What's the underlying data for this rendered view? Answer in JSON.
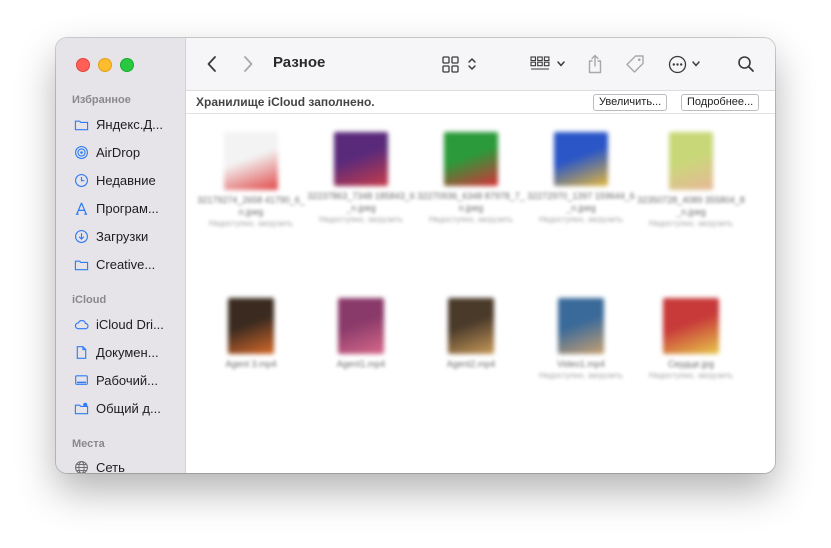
{
  "window": {
    "title": "Разное",
    "traffic_lights": [
      "close",
      "minimize",
      "zoom"
    ]
  },
  "sidebar": {
    "sections": [
      {
        "label": "Избранное",
        "items": [
          {
            "label": "Яндекс.Д...",
            "icon": "folder-icon"
          },
          {
            "label": "AirDrop",
            "icon": "airdrop-icon"
          },
          {
            "label": "Недавние",
            "icon": "clock-icon"
          },
          {
            "label": "Програм...",
            "icon": "apps-icon"
          },
          {
            "label": "Загрузки",
            "icon": "download-icon"
          },
          {
            "label": "Creative...",
            "icon": "folder-icon"
          }
        ]
      },
      {
        "label": "iCloud",
        "items": [
          {
            "label": "iCloud Dri...",
            "icon": "cloud-icon"
          },
          {
            "label": "Докумен...",
            "icon": "document-icon"
          },
          {
            "label": "Рабочий...",
            "icon": "desktop-icon"
          },
          {
            "label": "Общий д...",
            "icon": "shared-folder-icon"
          }
        ]
      },
      {
        "label": "Места",
        "items": [
          {
            "label": "Сеть",
            "icon": "network-icon"
          }
        ]
      }
    ]
  },
  "toolbar": {
    "icons": [
      "back-icon",
      "forward-icon",
      "grid-view-icon",
      "group-by-icon",
      "share-icon",
      "tag-icon",
      "more-icon",
      "search-icon"
    ]
  },
  "banner": {
    "text": "Хранилище iCloud заполнено.",
    "upgrade_label": "Увеличить...",
    "details_label": "Подробнее..."
  },
  "files": [
    {
      "name": "32179274_2658 41790_6_n.jpeg",
      "sub": "Недоступно, загрузить",
      "colors": [
        "#f3f3f3",
        "#e04848"
      ]
    },
    {
      "name": "32237863_7348 185843_6_n.jpeg",
      "sub": "Недоступно, загрузить",
      "colors": [
        "#5a2a7a",
        "#c83c4a"
      ]
    },
    {
      "name": "32270936_6348 87978_7_n.jpeg",
      "sub": "Недоступно, загрузить",
      "colors": [
        "#2a9a3a",
        "#d83038"
      ]
    },
    {
      "name": "32272970_1397 159644_6_n.jpeg",
      "sub": "Недоступно, загрузить",
      "colors": [
        "#2a56c8",
        "#e4b83a"
      ]
    },
    {
      "name": "32350728_4089 355804_8_n.jpeg",
      "sub": "Недоступно, загрузить",
      "colors": [
        "#c8d878",
        "#e8b898"
      ]
    },
    {
      "name": "Agent 3.mp4",
      "sub": "",
      "colors": [
        "#3a2a20",
        "#d86a2a"
      ]
    },
    {
      "name": "Agent1.mp4",
      "sub": "",
      "colors": [
        "#8a3a6a",
        "#d86a8a"
      ]
    },
    {
      "name": "Agent2.mp4",
      "sub": "",
      "colors": [
        "#4a3a2a",
        "#c89a5a"
      ]
    },
    {
      "name": "Video1.mp4",
      "sub": "Недоступно, загрузить",
      "colors": [
        "#3a6a9a",
        "#c8a070"
      ]
    },
    {
      "name": "Сердце.jpg",
      "sub": "Недоступно, загрузить",
      "colors": [
        "#c83a3a",
        "#e8c84a"
      ]
    }
  ]
}
